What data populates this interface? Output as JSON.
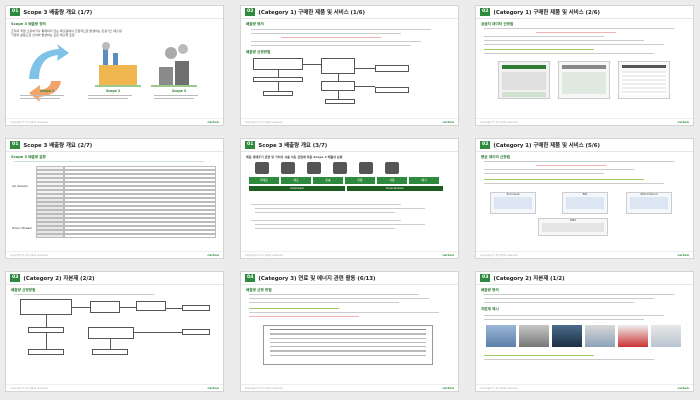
{
  "slides": [
    {
      "num": "01",
      "title": "Scope 3 배출량 개요 (1/7)",
      "section": "Scope 3 배출량 정의",
      "lines": [
        "조직의 직접 소유하거나 통제하지 않는 배출원에서 간접적으로 발생하는 온실가스 배출량",
        "기업의 활동으로 인하여 발생하는 모든 배출을 포함"
      ],
      "captions": [
        "Scope 1",
        "Scope 2",
        "Scope 3"
      ]
    },
    {
      "num": "02",
      "title": "(Category 1) 구매한 제품 및 서비스 (1/6)",
      "section": "배출량 정의",
      "section2": "배출량 산정방법"
    },
    {
      "num": "02",
      "title": "(Category 1) 구매한 제품 및 서비스 (2/6)",
      "section": "공급자 데이터 산정법"
    },
    {
      "num": "01",
      "title": "Scope 3 배출량 개요 (2/7)",
      "section": "Scope 3 배출량 분류",
      "groups": [
        "Up Stream",
        "Down Stream"
      ]
    },
    {
      "num": "01",
      "title": "Scope 3 배출량 개요 (3/7)",
      "lead": "제품 생애주기 관점 및 가치의 사슬 이동 관점에 따른 Scope 3 배출의 분류",
      "stages": [
        "원재료",
        "제조",
        "운송",
        "유통",
        "사용",
        "폐기"
      ],
      "labels": [
        "Upstream",
        "Downstream"
      ]
    },
    {
      "num": "02",
      "title": "(Category 1) 구매한 제품 및 서비스 (5/6)",
      "section": "평균 데이터 산정법",
      "panels": [
        "Ecoinvent",
        "EPA",
        "GHG Protocol",
        "IDEA"
      ]
    },
    {
      "num": "03",
      "title": "(Category 2) 자본재 (2/2)",
      "section": "배출량 산정방법"
    },
    {
      "num": "04",
      "title": "(Category 3) 연료 및 에너지 관련 활동 (6/13)",
      "section": "배출량 산정 방법"
    },
    {
      "num": "03",
      "title": "(Category 2) 자본재 (1/2)",
      "section": "배출량 정의",
      "section2": "자본재 예시"
    }
  ],
  "footer": {
    "copyright": "Copyright © All rights reserved.",
    "logo": "carbon"
  }
}
